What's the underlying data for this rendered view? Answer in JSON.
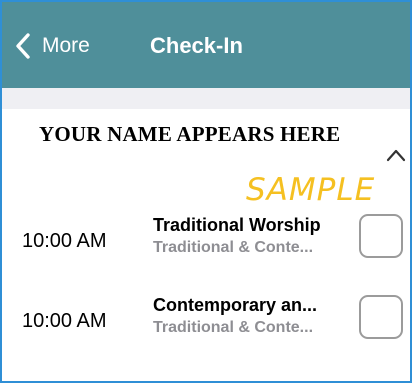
{
  "navbar": {
    "back_label": "More",
    "title": "Check-In",
    "background": "#4f8f9a",
    "back_icon": "chevron-left-icon"
  },
  "section": {
    "person_name": "YOUR NAME APPEARS HERE",
    "toggle_icon": "chevron-up-icon",
    "expanded": true
  },
  "watermark": {
    "text": "SAMPLE",
    "color": "#f5c021"
  },
  "services": [
    {
      "time": "10:00 AM",
      "title": "Traditional Worship",
      "subtitle": "Traditional & Conte...",
      "checked": false
    },
    {
      "time": "10:00 AM",
      "title": "Contemporary an...",
      "subtitle": "Traditional & Conte...",
      "checked": false
    }
  ],
  "colors": {
    "accent_border": "#2f8fd6",
    "subtitle_gray": "#8e8e93",
    "separator": "#efeff3"
  }
}
